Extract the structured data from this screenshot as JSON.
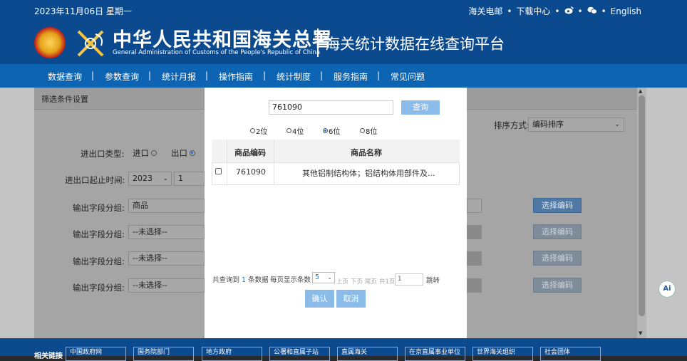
{
  "header": {
    "date": "2023年11月06日 星期一",
    "links": {
      "mail": "海关电邮",
      "download": "下载中心",
      "sep": "•",
      "weibo_icon": "weibo-icon",
      "wechat_icon": "wechat-icon",
      "english": "English"
    },
    "cn_title": "中华人民共和国海关总署",
    "en_title": "General Administration of Customs of the People's Republic of China",
    "platform_title": "海关统计数据在线查询平台"
  },
  "nav": {
    "items": [
      "数据查询",
      "参数查询",
      "统计月报",
      "操作指南",
      "统计制度",
      "服务指南",
      "常见问题"
    ],
    "separator": "|"
  },
  "background": {
    "filter_title": "筛选条件设置",
    "sort_label": "排序方式:",
    "sort_value": "编码排序",
    "trade_type_label": "进出口类型:",
    "import_label": "进口",
    "export_label": "出口",
    "period_label": "进出口起止时间:",
    "year_value": "2023",
    "month_value": "1",
    "group_label": "输出字段分组:",
    "group1_value": "商品",
    "unselected": "--未选择--",
    "select_code_button": "选择编码"
  },
  "modal": {
    "code_input_value": "761090",
    "query_button": "查询",
    "radios": [
      {
        "label": "2位",
        "checked": false
      },
      {
        "label": "4位",
        "checked": false
      },
      {
        "label": "6位",
        "checked": true
      },
      {
        "label": "8位",
        "checked": false
      }
    ],
    "table": {
      "col_code": "商品编码",
      "col_name": "商品名称",
      "rows": [
        {
          "code": "761090",
          "name": "其他铝制结构体；铝结构体用部件及..."
        }
      ]
    },
    "pagination": {
      "found_prefix": "共查询到",
      "found_count": "1",
      "found_suffix": "条数据",
      "per_page_label": "每页显示条数",
      "per_page_value": "5",
      "prev": "上页",
      "next": "下页",
      "last": "尾页",
      "total_pages": "共1页",
      "page_input_value": "1",
      "jump": "跳转"
    },
    "confirm_button": "确认",
    "cancel_button": "取消"
  },
  "footer": {
    "label": "相关链接",
    "links": [
      "中国政府网",
      "国务院部门",
      "地方政府",
      "公署和直属子站",
      "直属海关",
      "在京直属事业单位",
      "世界海关组织",
      "社会团体"
    ]
  },
  "ai_badge": "Ai",
  "colors": {
    "header_bg": "#0c4a8f",
    "nav_bg": "#0d64b3",
    "button_blue": "#8bbbe8",
    "selected_radio": "#1a6fd6",
    "count_highlight": "#1a7cd0"
  }
}
